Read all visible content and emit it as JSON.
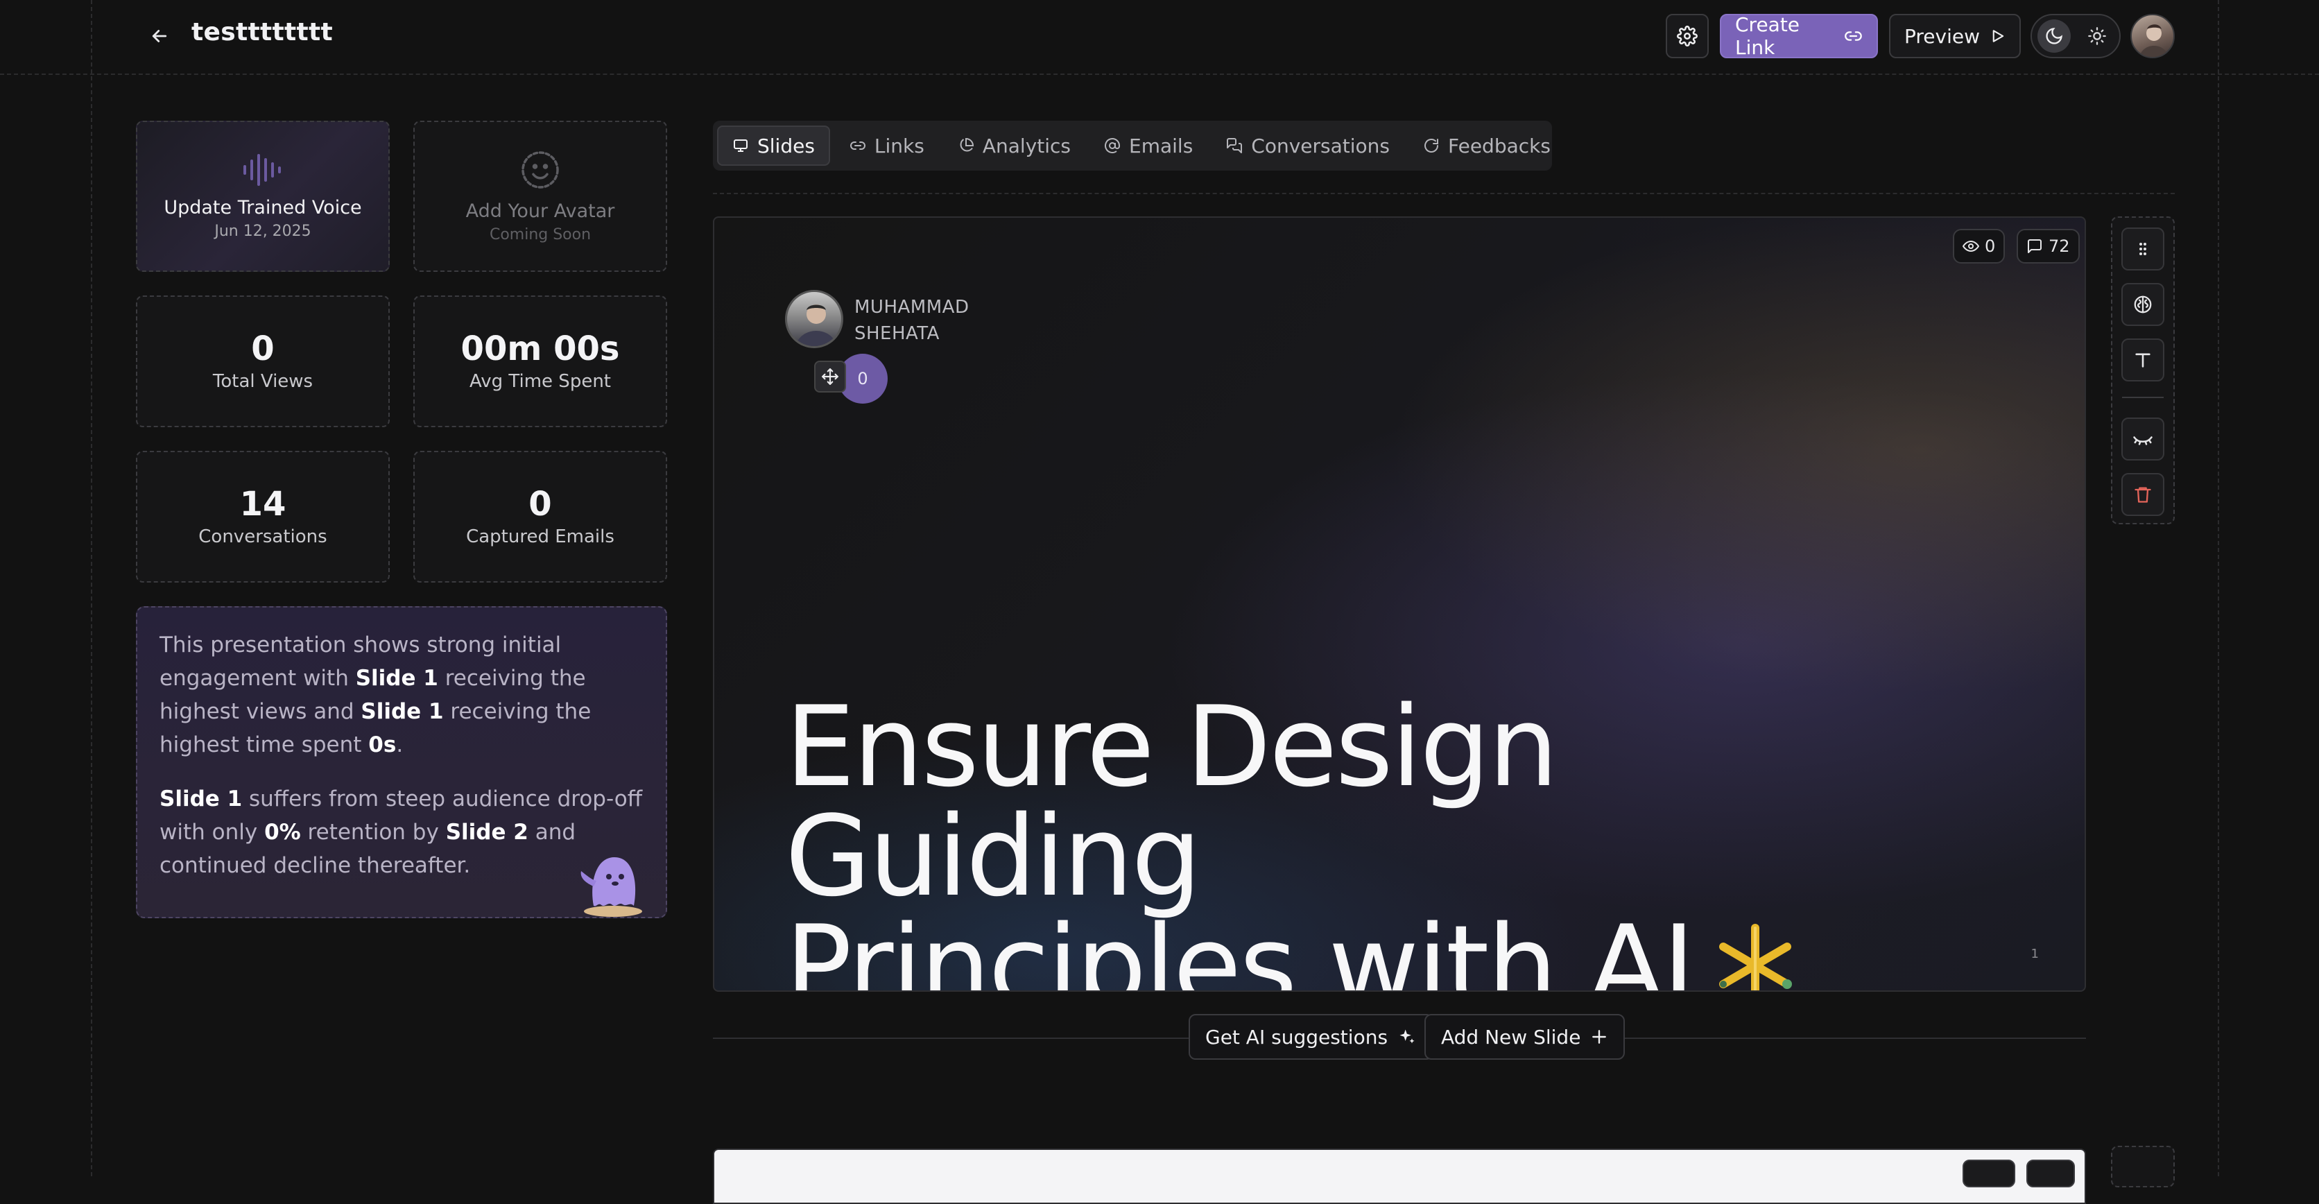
{
  "header": {
    "title": "testttttttt",
    "create_link_label": "Create Link",
    "preview_label": "Preview"
  },
  "stats": {
    "voice": {
      "title": "Update Trained Voice",
      "date": "Jun 12, 2025"
    },
    "avatar": {
      "title": "Add Your Avatar",
      "status": "Coming Soon"
    },
    "total_views": {
      "value": "0",
      "label": "Total Views"
    },
    "avg_time": {
      "value": "00m 00s",
      "label": "Avg Time Spent"
    },
    "conversations": {
      "value": "14",
      "label": "Conversations"
    },
    "captured_emails": {
      "value": "0",
      "label": "Captured Emails"
    }
  },
  "insight": {
    "p1": {
      "t1": "This presentation shows strong initial engagement with ",
      "b1": "Slide 1",
      "t2": " receiving the highest views and ",
      "b2": "Slide 1",
      "t3": " receiving the highest time spent ",
      "b3": "0s",
      "t4": "."
    },
    "p2": {
      "b1": "Slide 1",
      "t1": " suffers from steep audience drop-off with only ",
      "b2": "0%",
      "t2": " retention by ",
      "b3": "Slide 2",
      "t3": " and continued decline thereafter."
    }
  },
  "tabs": [
    {
      "label": "Slides",
      "icon": "monitor-icon"
    },
    {
      "label": "Links",
      "icon": "link-icon"
    },
    {
      "label": "Analytics",
      "icon": "pie-chart-icon"
    },
    {
      "label": "Emails",
      "icon": "at-sign-icon"
    },
    {
      "label": "Conversations",
      "icon": "chat-bubbles-icon"
    },
    {
      "label": "Feedbacks",
      "icon": "refresh-icon"
    }
  ],
  "slide": {
    "views": "0",
    "comments": "72",
    "author_first": "MUHAMMAD",
    "author_last": "SHEHATA",
    "bubble_count": "0",
    "headline_line1": "Ensure Design Guiding",
    "headline_line2": "Principles with AI",
    "number": "1"
  },
  "actions": {
    "ai_suggestions": "Get AI suggestions",
    "add_slide": "Add New Slide"
  },
  "colors": {
    "accent": "#7a63b8",
    "background": "#121212",
    "insight_bg": "#27223a"
  }
}
